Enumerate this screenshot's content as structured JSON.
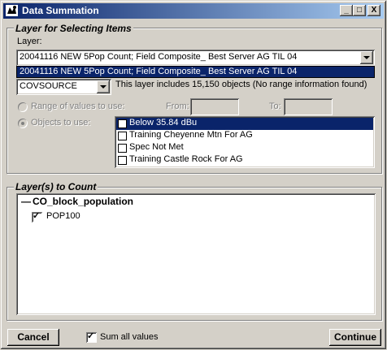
{
  "window": {
    "title": "Data Summation"
  },
  "title_buttons": {
    "minimize": "_",
    "maximize": "□",
    "close": "X"
  },
  "select_group": {
    "legend": "Layer for Selecting Items",
    "layer_label": "Layer:",
    "layer_value": "20041116 NEW 5Pop Count; Field Composite_ Best Server AG TIL 04",
    "layer_dropdown_item": "20041116 NEW 5Pop Count; Field Composite_ Best Server AG TIL 04",
    "field_value": "COVSOURCE",
    "info_text": "This layer includes 15,150 objects (No range information found)",
    "range_label": "Range of values to use:",
    "from_label": "From:",
    "from_value": "",
    "to_label": "To:",
    "to_value": "",
    "objects_label": "Objects to use:",
    "objects": [
      {
        "label": "Below 35.84 dBu",
        "checked": false,
        "selected": true
      },
      {
        "label": "Training Cheyenne Mtn For AG",
        "checked": false,
        "selected": false
      },
      {
        "label": "Spec Not Met",
        "checked": false,
        "selected": false
      },
      {
        "label": "Training Castle Rock For AG",
        "checked": false,
        "selected": false
      }
    ]
  },
  "count_group": {
    "legend": "Layer(s) to Count",
    "tree_root_prefix": "—",
    "tree_root": "CO_block_population",
    "tree_child": "POP100",
    "tree_child_checked": true
  },
  "footer": {
    "cancel": "Cancel",
    "sum_all": "Sum all values",
    "sum_all_checked": true,
    "continue": "Continue"
  }
}
